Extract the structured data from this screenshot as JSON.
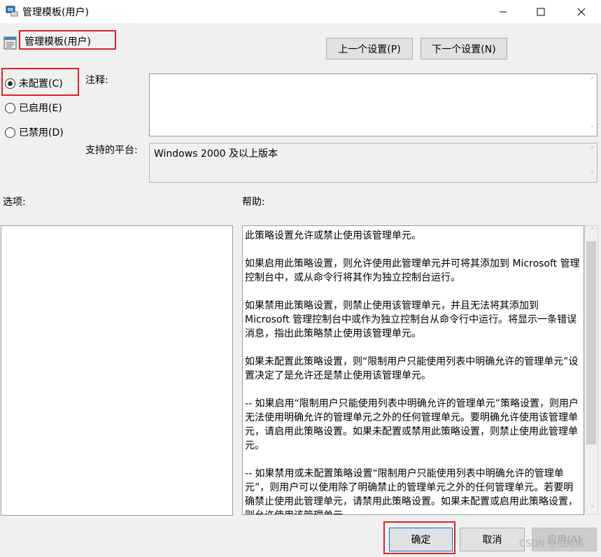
{
  "window": {
    "title": "管理模板(用户)",
    "minimize_icon": "minimize-icon",
    "maximize_icon": "maximize-icon",
    "close_icon": "close-icon"
  },
  "header": {
    "policy_name": "管理模板(用户)",
    "prev_button": "上一个设置(P)",
    "next_button": "下一个设置(N)"
  },
  "state": {
    "options": [
      {
        "label": "未配置(C)",
        "selected": true
      },
      {
        "label": "已启用(E)",
        "selected": false
      },
      {
        "label": "已禁用(D)",
        "selected": false
      }
    ]
  },
  "comment": {
    "label": "注释:",
    "value": ""
  },
  "platform": {
    "label": "支持的平台:",
    "value": "Windows 2000 及以上版本"
  },
  "options_section": {
    "label": "选项:"
  },
  "help_section": {
    "label": "帮助:",
    "paragraphs": [
      "此策略设置允许或禁止使用该管理单元。",
      "如果启用此策略设置，则允许使用此管理单元并可将其添加到 Microsoft 管理控制台中，或从命令行将其作为独立控制台运行。",
      "如果禁用此策略设置，则禁止使用该管理单元，并且无法将其添加到 Microsoft 管理控制台中或作为独立控制台从命令行中运行。将显示一条错误消息，指出此策略禁止使用该管理单元。",
      "如果未配置此策略设置，则“限制用户只能使用列表中明确允许的管理单元”设置决定了是允许还是禁止使用该管理单元。",
      "-- 如果启用“限制用户只能使用列表中明确允许的管理单元”策略设置，则用户无法使用明确允许的管理单元之外的任何管理单元。要明确允许使用该管理单元，请启用此策略设置。如果未配置或禁用此策略设置，则禁止使用此管理单元。",
      "-- 如果禁用或未配置策略设置“限制用户只能使用列表中明确允许的管理单元”，则用户可以使用除了明确禁止的管理单元之外的任何管理单元。若要明确禁止使用此管理单元，请禁用此策略设置。如果未配置或启用此策略设置，则允许使用该管理单元。"
    ]
  },
  "footer": {
    "ok": "确定",
    "cancel": "取消",
    "apply": "应用(A)",
    "watermark": "CSDN @肌肉苏"
  }
}
